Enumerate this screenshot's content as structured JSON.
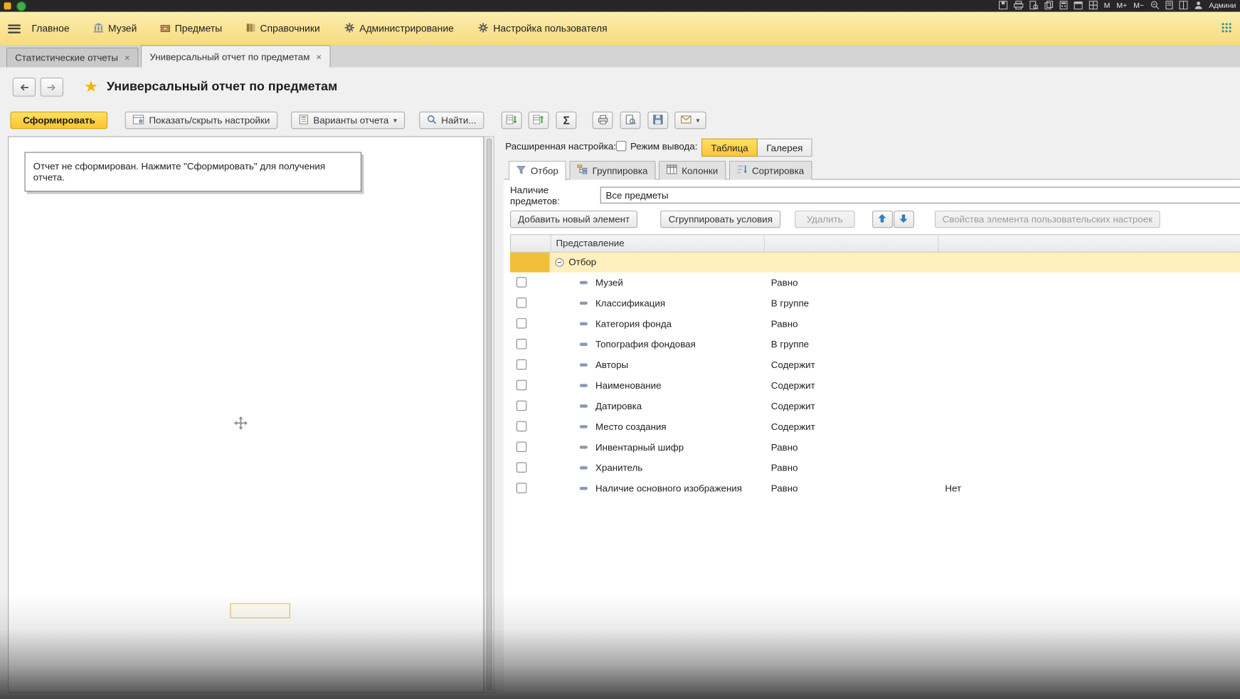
{
  "titlebar": {
    "user": "Админи",
    "memory_buttons": [
      "M",
      "M+",
      "M−"
    ]
  },
  "menubar": {
    "items": [
      "Главное",
      "Музей",
      "Предметы",
      "Справочники",
      "Администрирование",
      "Настройка пользователя"
    ]
  },
  "tabs": [
    {
      "label": "Статистические отчеты"
    },
    {
      "label": "Универсальный отчет по предметам"
    }
  ],
  "page": {
    "title": "Универсальный отчет по предметам"
  },
  "toolbar": {
    "generate": "Сформировать",
    "toggle_settings": "Показать/скрыть настройки",
    "variants": "Варианты отчета",
    "find": "Найти..."
  },
  "report": {
    "empty_message": "Отчет не сформирован. Нажмите \"Сформировать\" для получения отчета."
  },
  "settings": {
    "advanced_label": "Расширенная настройка:",
    "output_mode_label": "Режим вывода:",
    "output_modes": [
      "Таблица",
      "Галерея"
    ],
    "selected_output_mode": "Таблица",
    "tabs": [
      "Отбор",
      "Группировка",
      "Колонки",
      "Сортировка"
    ],
    "active_tab": "Отбор",
    "availability_label": "Наличие предметов:",
    "availability_value": "Все предметы",
    "buttons": {
      "add": "Добавить новый элемент",
      "group": "Сгруппировать условия",
      "delete": "Удалить",
      "properties": "Свойства элемента пользовательских настроек"
    },
    "table": {
      "header": "Представление",
      "group_row": "Отбор",
      "rows": [
        {
          "field": "Музей",
          "condition": "Равно",
          "value": ""
        },
        {
          "field": "Классификация",
          "condition": "В группе",
          "value": ""
        },
        {
          "field": "Категория фонда",
          "condition": "Равно",
          "value": ""
        },
        {
          "field": "Топография фондовая",
          "condition": "В группе",
          "value": ""
        },
        {
          "field": "Авторы",
          "condition": "Содержит",
          "value": ""
        },
        {
          "field": "Наименование",
          "condition": "Содержит",
          "value": ""
        },
        {
          "field": "Датировка",
          "condition": "Содержит",
          "value": ""
        },
        {
          "field": "Место создания",
          "condition": "Содержит",
          "value": ""
        },
        {
          "field": "Инвентарный шифр",
          "condition": "Равно",
          "value": ""
        },
        {
          "field": "Хранитель",
          "condition": "Равно",
          "value": ""
        },
        {
          "field": "Наличие основного изображения",
          "condition": "Равно",
          "value": "Нет"
        }
      ]
    }
  },
  "glyphs": {
    "close": "×",
    "caret": "▾",
    "star": "★",
    "sigma": "Σ"
  },
  "colors": {
    "accent_yellow": "#fbc63a",
    "menubar_yellow": "#f9e08c",
    "titlebar": "#262626",
    "group_row": "#fff0bd"
  }
}
